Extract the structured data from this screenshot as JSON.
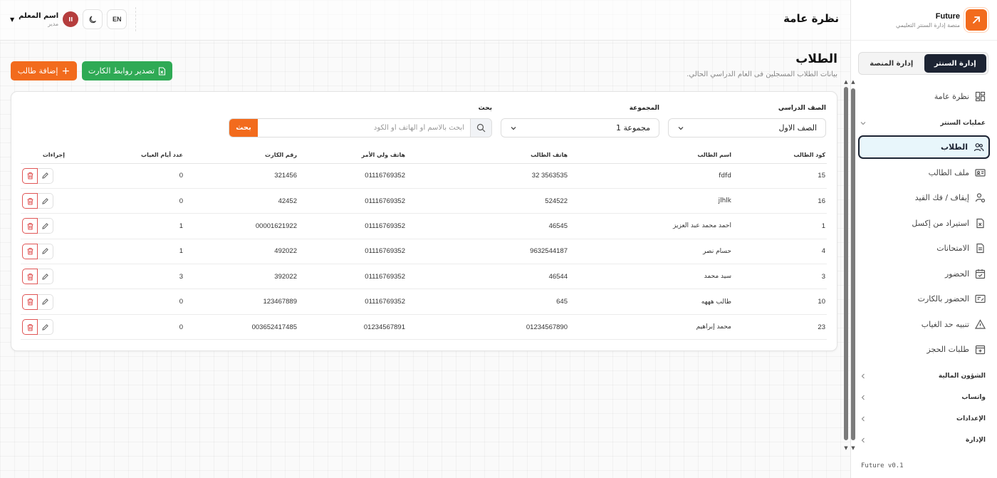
{
  "brand": {
    "name": "Future",
    "subtitle": "منصة إدارة السنتر التعليمي"
  },
  "sidebar": {
    "segments": [
      {
        "label": "إدارة السنتر",
        "active": true
      },
      {
        "label": "إدارة المنصة",
        "active": false
      }
    ],
    "overview": {
      "label": "نظرة عامة",
      "icon": "layout-grid-icon"
    },
    "ops_group": "عمليات السنتر",
    "items": [
      {
        "label": "الطلاب",
        "icon": "users-icon",
        "active": true
      },
      {
        "label": "ملف الطالب",
        "icon": "id-card-icon"
      },
      {
        "label": "إيقاف / فك القيد",
        "icon": "user-lock-icon"
      },
      {
        "label": "استيراد من إكسل",
        "icon": "excel-file-icon"
      },
      {
        "label": "الامتحانات",
        "icon": "document-icon"
      },
      {
        "label": "الحضور",
        "icon": "calendar-check-icon"
      },
      {
        "label": "الحضور بالكارت",
        "icon": "card-scan-icon"
      },
      {
        "label": "تنبيه حد الغياب",
        "icon": "warning-icon"
      },
      {
        "label": "طلبات الحجز",
        "icon": "calendar-plus-icon"
      }
    ],
    "groups": [
      "الشؤون المالية",
      "واتساب",
      "الإعدادات",
      "الإدارة"
    ],
    "version": "Future v0.1"
  },
  "header": {
    "title": "نظرة عامة",
    "lang": "EN",
    "user_name": "اسم المعلم",
    "user_role": "مدير",
    "avatar_initial": "II"
  },
  "main": {
    "title": "الطلاب",
    "subtitle": "بيانات الطلاب المسجلين فى العام الدراسي الحالي.",
    "add_button": "إضافة طالب",
    "export_button": "تصدير روابط الكارت",
    "filters": {
      "grade_label": "الصف الدراسي",
      "grade_value": "الصف الاول",
      "group_label": "المجموعة",
      "group_value": "مجموعة 1",
      "search_label": "بحث",
      "search_placeholder": "ابحث بالاسم أو الهاتف أو الكود",
      "search_button": "بحث"
    },
    "columns": [
      "كود الطالب",
      "اسم الطالب",
      "هاتف الطالب",
      "هاتف ولي الأمر",
      "رقم الكارت",
      "عدد أيام الغياب",
      "إجراءات"
    ],
    "rows": [
      [
        "15",
        "fdfd",
        "3563535 32",
        "01116769352",
        "321456",
        "0"
      ],
      [
        "16",
        "jlhlk",
        "524522",
        "01116769352",
        "42452",
        "0"
      ],
      [
        "1",
        "احمد محمد عبد العزيز",
        "46545",
        "01116769352",
        "00001621922",
        "1"
      ],
      [
        "4",
        "حسام نصر",
        "9632544187",
        "01116769352",
        "492022",
        "1"
      ],
      [
        "3",
        "سيد محمد",
        "46544",
        "01116769352",
        "392022",
        "3"
      ],
      [
        "10",
        "طالب هههه",
        "645",
        "01116769352",
        "123467889",
        "0"
      ],
      [
        "23",
        "محمد إبراهيم",
        "01234567890",
        "01234567891",
        "003652417485",
        "0"
      ]
    ]
  },
  "colors": {
    "accent": "#f26b1d",
    "dark": "#1d2433",
    "success": "#2faa55",
    "danger": "#e05555"
  }
}
